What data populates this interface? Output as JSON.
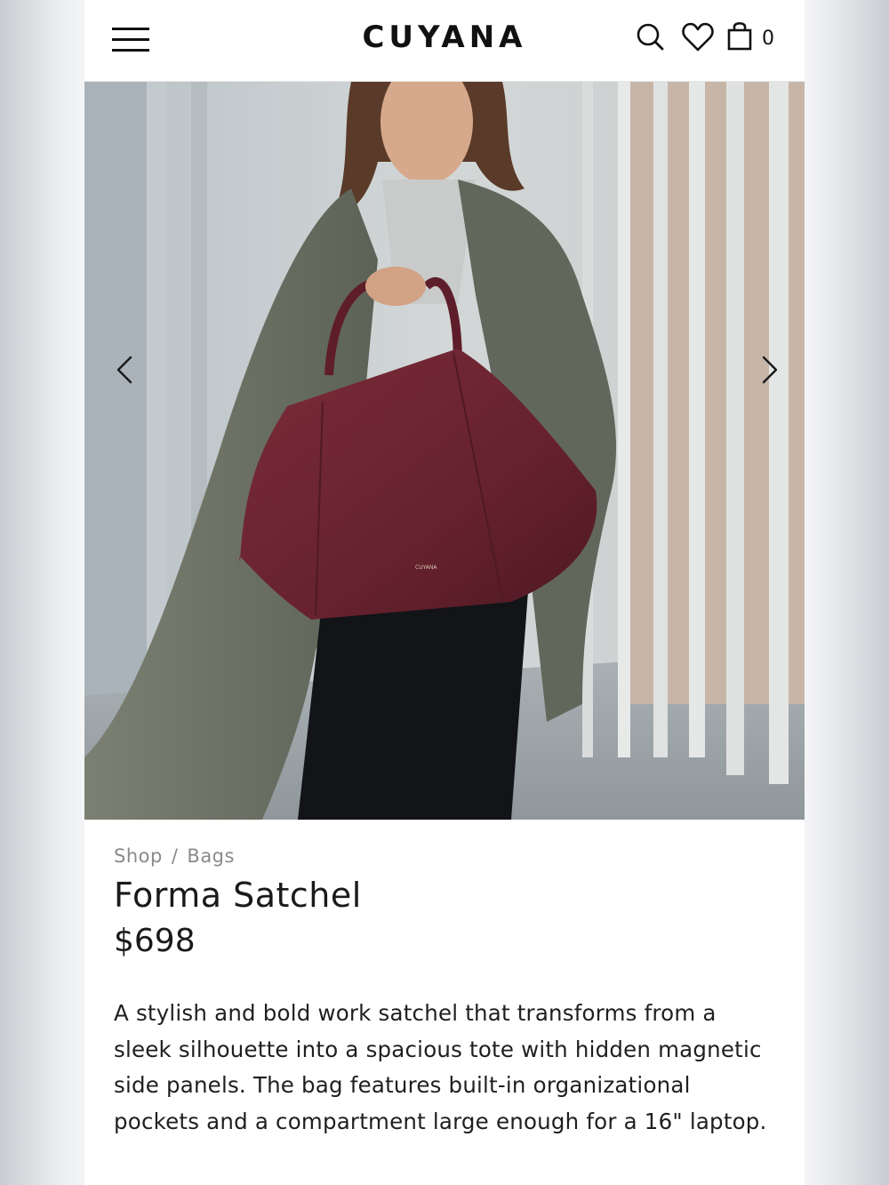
{
  "header": {
    "logo": "CUYANA",
    "cart_count": "0",
    "icons": [
      "menu-icon",
      "search-icon",
      "heart-icon",
      "shopping-bag-icon"
    ]
  },
  "hero": {
    "prev_icon": "chevron-left-icon",
    "next_icon": "chevron-right-icon"
  },
  "breadcrumb": {
    "items": [
      "Shop",
      "Bags"
    ],
    "separator": "/"
  },
  "product": {
    "title": "Forma Satchel",
    "price": "$698",
    "description": "A stylish and bold work satchel that transforms from a sleek silhouette into a spacious tote with hidden magnetic side panels. The bag features built-in organizational pockets and a compartment large enough for a 16\" laptop."
  },
  "colors": {
    "bag": "#6a2330",
    "coat": "#6e7466",
    "text": "#1a1a1a",
    "muted": "#8a8a8a"
  }
}
